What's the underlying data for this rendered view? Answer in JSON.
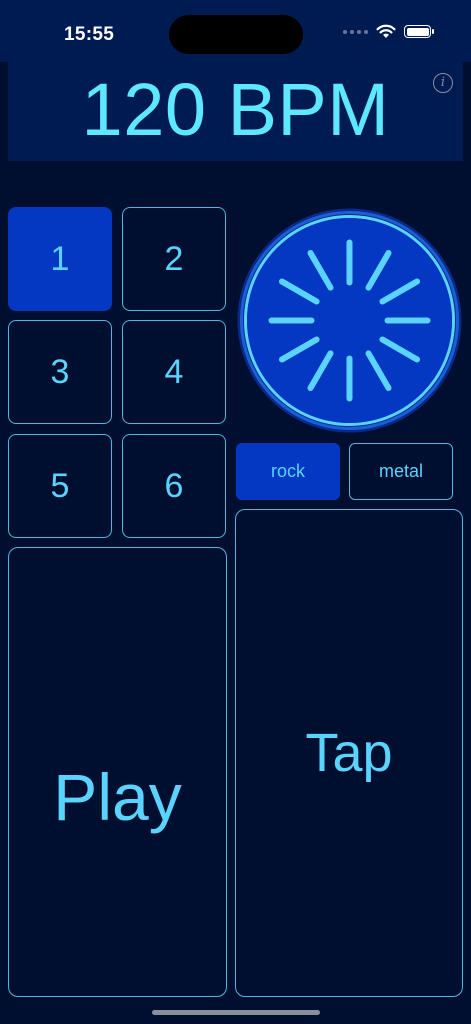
{
  "status_bar": {
    "time": "15:55"
  },
  "header": {
    "bpm_text": "120 BPM",
    "info_icon": "i"
  },
  "beats": {
    "buttons": [
      "1",
      "2",
      "3",
      "4",
      "5",
      "6"
    ],
    "selected": "1"
  },
  "styles": {
    "options": [
      "rock",
      "metal"
    ],
    "selected": "rock"
  },
  "pads": {
    "play_label": "Play",
    "tap_label": "Tap"
  },
  "colors": {
    "background": "#000f30",
    "header": "#001a52",
    "accent": "#0438c2",
    "text": "#5ad4ff",
    "border": "#4fb6dc"
  },
  "icons": {
    "status": [
      "wifi-icon",
      "battery-icon",
      "cellular-signal-icon"
    ],
    "info": "info-icon",
    "dial": "rotary-dial-icon"
  }
}
